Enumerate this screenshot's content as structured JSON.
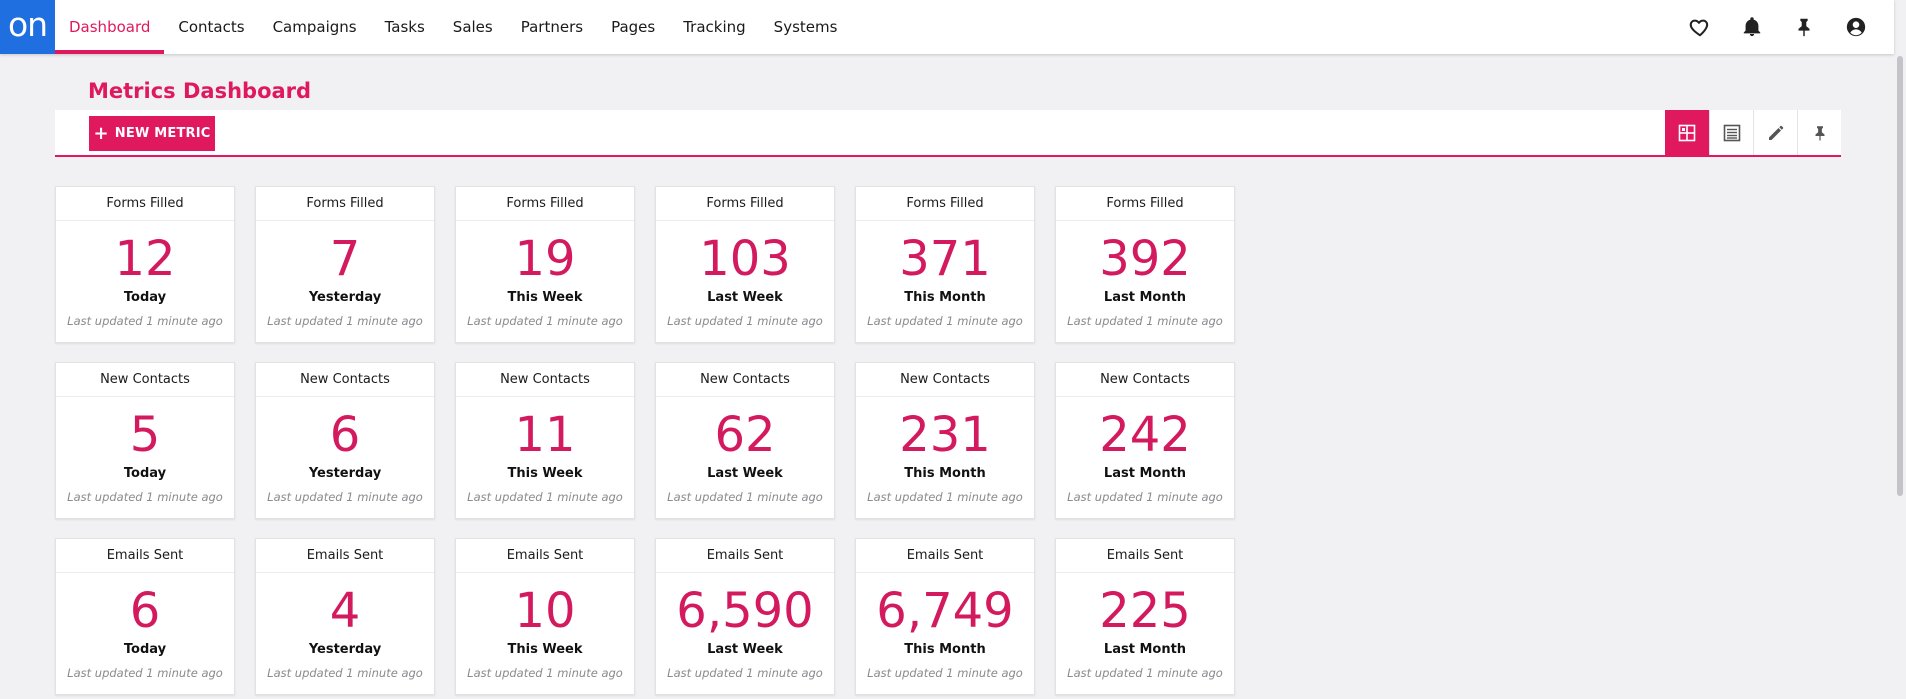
{
  "brand": {
    "logo_text": "on",
    "logo_color": "#1f6fe0",
    "accent_color": "#e0185e"
  },
  "nav": {
    "items": [
      "Dashboard",
      "Contacts",
      "Campaigns",
      "Tasks",
      "Sales",
      "Partners",
      "Pages",
      "Tracking",
      "Systems"
    ],
    "active": "Dashboard",
    "right_icons": [
      "heart-icon",
      "bell-icon",
      "pin-icon",
      "account-icon"
    ]
  },
  "page": {
    "title": "Metrics Dashboard"
  },
  "toolbar": {
    "new_metric_label": "NEW METRIC",
    "view_buttons": [
      "grid-view-icon",
      "list-view-icon",
      "edit-icon",
      "pin-icon"
    ],
    "active_view": "grid-view-icon"
  },
  "cards": [
    {
      "title": "Forms Filled",
      "value": "12",
      "period": "Today",
      "updated": "Last updated 1 minute ago"
    },
    {
      "title": "Forms Filled",
      "value": "7",
      "period": "Yesterday",
      "updated": "Last updated 1 minute ago"
    },
    {
      "title": "Forms Filled",
      "value": "19",
      "period": "This Week",
      "updated": "Last updated 1 minute ago"
    },
    {
      "title": "Forms Filled",
      "value": "103",
      "period": "Last Week",
      "updated": "Last updated 1 minute ago"
    },
    {
      "title": "Forms Filled",
      "value": "371",
      "period": "This Month",
      "updated": "Last updated 1 minute ago"
    },
    {
      "title": "Forms Filled",
      "value": "392",
      "period": "Last Month",
      "updated": "Last updated 1 minute ago"
    },
    {
      "title": "New Contacts",
      "value": "5",
      "period": "Today",
      "updated": "Last updated 1 minute ago"
    },
    {
      "title": "New Contacts",
      "value": "6",
      "period": "Yesterday",
      "updated": "Last updated 1 minute ago"
    },
    {
      "title": "New Contacts",
      "value": "11",
      "period": "This Week",
      "updated": "Last updated 1 minute ago"
    },
    {
      "title": "New Contacts",
      "value": "62",
      "period": "Last Week",
      "updated": "Last updated 1 minute ago"
    },
    {
      "title": "New Contacts",
      "value": "231",
      "period": "This Month",
      "updated": "Last updated 1 minute ago"
    },
    {
      "title": "New Contacts",
      "value": "242",
      "period": "Last Month",
      "updated": "Last updated 1 minute ago"
    },
    {
      "title": "Emails Sent",
      "value": "6",
      "period": "Today",
      "updated": "Last updated 1 minute ago"
    },
    {
      "title": "Emails Sent",
      "value": "4",
      "period": "Yesterday",
      "updated": "Last updated 1 minute ago"
    },
    {
      "title": "Emails Sent",
      "value": "10",
      "period": "This Week",
      "updated": "Last updated 1 minute ago"
    },
    {
      "title": "Emails Sent",
      "value": "6,590",
      "period": "Last Week",
      "updated": "Last updated 1 minute ago"
    },
    {
      "title": "Emails Sent",
      "value": "6,749",
      "period": "This Month",
      "updated": "Last updated 1 minute ago"
    },
    {
      "title": "Emails Sent",
      "value": "225",
      "period": "Last Month",
      "updated": "Last updated 1 minute ago"
    }
  ]
}
